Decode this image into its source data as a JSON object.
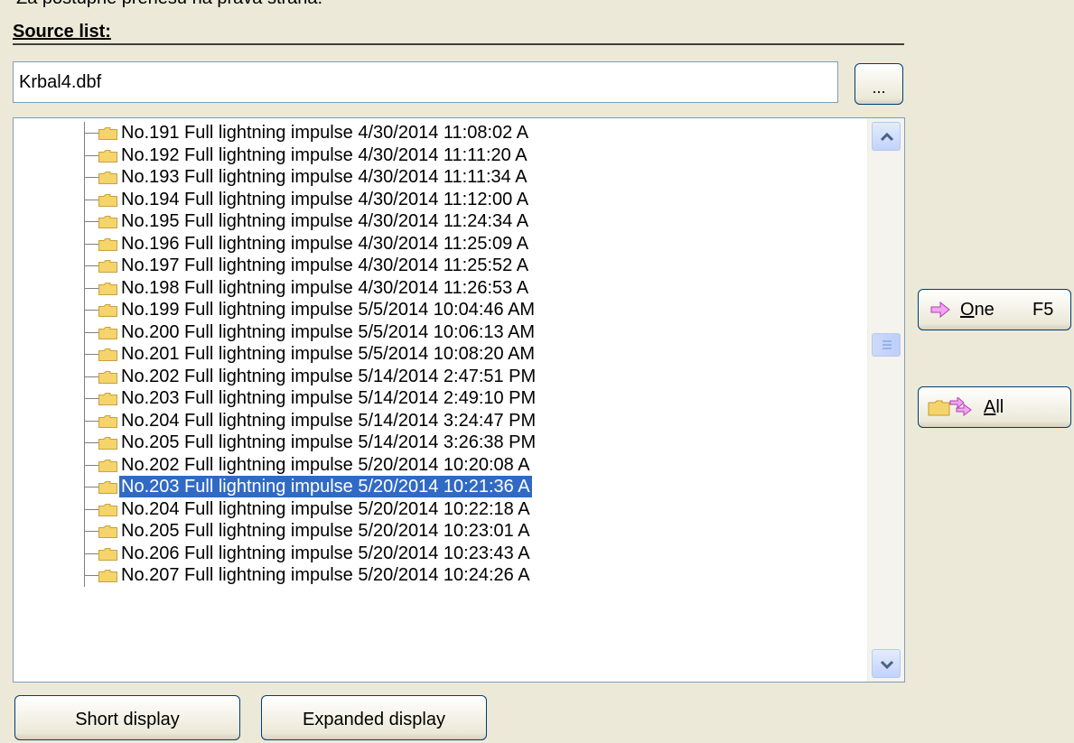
{
  "top_text": "Za postupné přenesu na pravá strana.",
  "source_list": {
    "title": "Source list:",
    "path_value": "Krbal4.dbf",
    "browse_label": "...",
    "items": [
      {
        "text": "No.191  Full lightning impulse 4/30/2014 11:08:02 A",
        "selected": false
      },
      {
        "text": "No.192  Full lightning impulse 4/30/2014 11:11:20 A",
        "selected": false
      },
      {
        "text": "No.193  Full lightning impulse 4/30/2014 11:11:34 A",
        "selected": false
      },
      {
        "text": "No.194  Full lightning impulse 4/30/2014 11:12:00 A",
        "selected": false
      },
      {
        "text": "No.195  Full lightning impulse 4/30/2014 11:24:34 A",
        "selected": false
      },
      {
        "text": "No.196  Full lightning impulse 4/30/2014 11:25:09 A",
        "selected": false
      },
      {
        "text": "No.197  Full lightning impulse 4/30/2014 11:25:52 A",
        "selected": false
      },
      {
        "text": "No.198  Full lightning impulse 4/30/2014 11:26:53 A",
        "selected": false
      },
      {
        "text": "No.199  Full lightning impulse 5/5/2014 10:04:46 AM",
        "selected": false
      },
      {
        "text": "No.200  Full lightning impulse 5/5/2014 10:06:13 AM",
        "selected": false
      },
      {
        "text": "No.201  Full lightning impulse 5/5/2014 10:08:20 AM",
        "selected": false
      },
      {
        "text": "No.202  Full lightning impulse 5/14/2014 2:47:51 PM",
        "selected": false
      },
      {
        "text": "No.203  Full lightning impulse 5/14/2014 2:49:10 PM",
        "selected": false
      },
      {
        "text": "No.204  Full lightning impulse 5/14/2014 3:24:47 PM",
        "selected": false
      },
      {
        "text": "No.205  Full lightning impulse 5/14/2014 3:26:38 PM",
        "selected": false
      },
      {
        "text": "No.202  Full lightning impulse 5/20/2014 10:20:08 A",
        "selected": false
      },
      {
        "text": "No.203  Full lightning impulse 5/20/2014 10:21:36 A",
        "selected": true
      },
      {
        "text": "No.204  Full lightning impulse 5/20/2014 10:22:18 A",
        "selected": false
      },
      {
        "text": "No.205  Full lightning impulse 5/20/2014 10:23:01 A",
        "selected": false
      },
      {
        "text": "No.206  Full lightning impulse 5/20/2014 10:23:43 A",
        "selected": false
      },
      {
        "text": "No.207  Full lightning impulse 5/20/2014 10:24:26 A",
        "selected": false
      }
    ]
  },
  "buttons": {
    "one_accel": "O",
    "one_rest": "ne",
    "one_shortcut": "F5",
    "all_accel": "A",
    "all_rest": "ll",
    "short_display": "Short display",
    "expanded_display": "Expanded display"
  },
  "colors": {
    "selection": "#316ac5",
    "folder": "#f5d46b",
    "arrow": "#e58fe5"
  },
  "icons": {
    "folder": "folder-icon",
    "arrow_right": "arrow-right-icon",
    "scroll_up": "chevron-up-icon",
    "scroll_down": "chevron-down-icon"
  }
}
